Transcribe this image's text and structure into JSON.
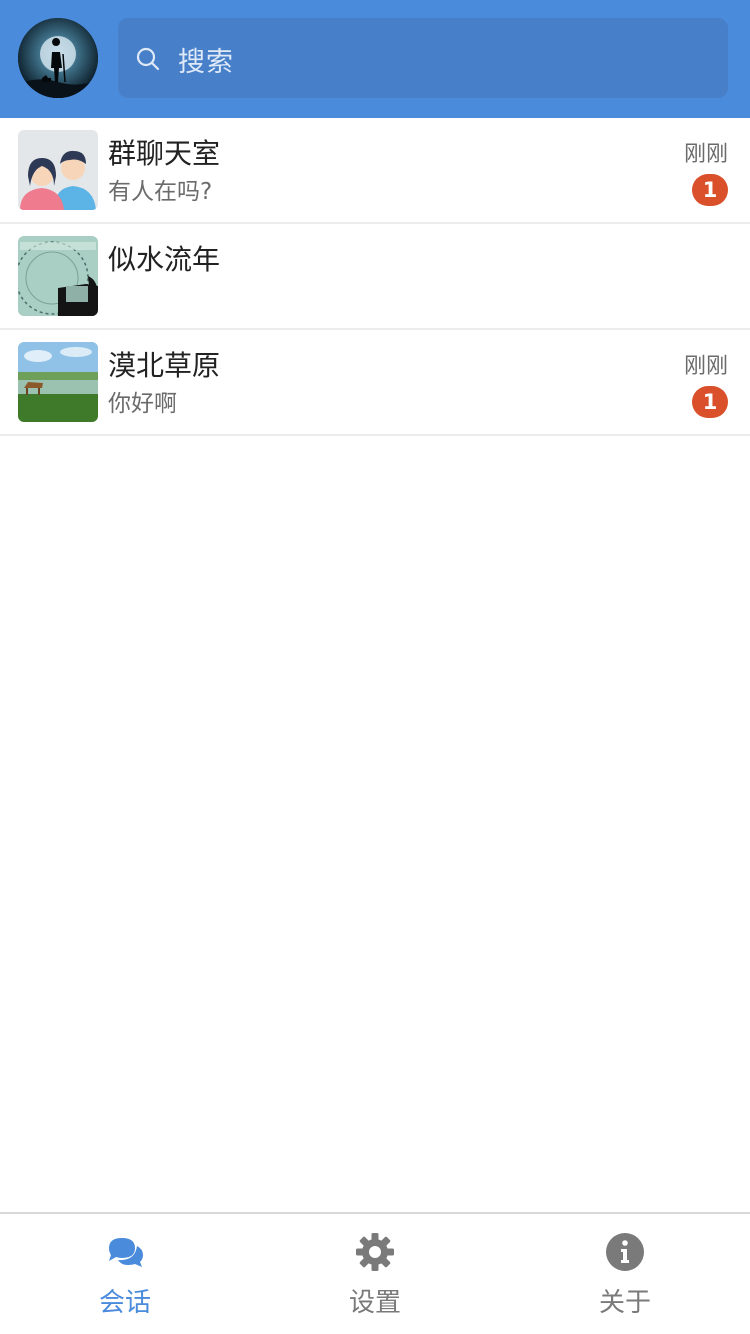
{
  "header": {
    "search_placeholder": "搜索"
  },
  "chats": [
    {
      "name": "群聊天室",
      "message": "有人在吗?",
      "time": "刚刚",
      "unread": "1"
    },
    {
      "name": "似水流年",
      "message": "",
      "time": "",
      "unread": ""
    },
    {
      "name": "漠北草原",
      "message": "你好啊",
      "time": "刚刚",
      "unread": "1"
    }
  ],
  "tabs": [
    {
      "label": "会话",
      "icon": "chat-bubbles-icon",
      "active": true
    },
    {
      "label": "设置",
      "icon": "gear-icon",
      "active": false
    },
    {
      "label": "关于",
      "icon": "info-icon",
      "active": false
    }
  ],
  "colors": {
    "header": "#4a8bdc",
    "badge": "#d9502b",
    "active_tab": "#4a8bdc"
  }
}
